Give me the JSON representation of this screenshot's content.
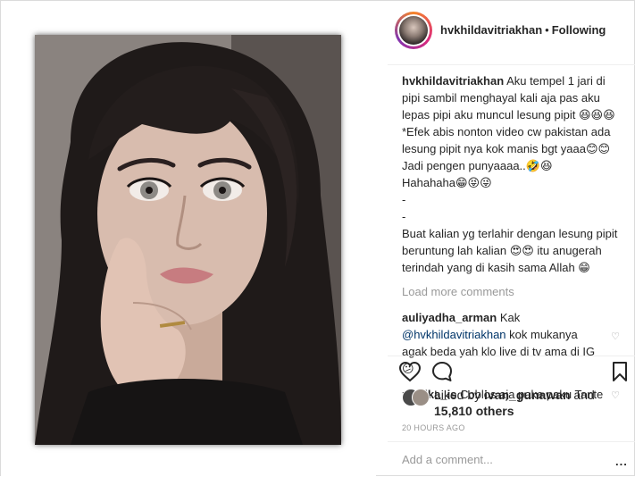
{
  "header": {
    "username": "hvkhildavitriakhan",
    "separator": "•",
    "follow_status": "Following"
  },
  "caption": {
    "username": "hvkhildavitriakhan",
    "text": "Aku tempel 1 jari di pipi sambil menghayal kali aja pas aku lepas pipi aku muncul lesung pipit 😆😆😆\n*Efek abis nonton video cw pakistan ada lesung pipit nya kok manis bgt yaaa😊😊\nJadi pengen punyaaaa..🤣😆\nHahahaha😁😝😜\n-\n-\nBuat kalian yg terlahir dengan lesung pipit beruntung lah kalian 😍😍 itu anugerah terindah yang di kasih sama Allah 😁"
  },
  "load_more": "Load more comments",
  "comments": [
    {
      "username": "auliyadha_arman",
      "text_before": "Kak",
      "mention": "@hvkhildavitriakhan",
      "text_after": "kok mukanya agak beda yah klo live di tv ama di IG 😕"
    },
    {
      "username": "zulaika_is",
      "text_before": "Coblos aja pake paku Tante",
      "mention": "",
      "text_after": ""
    }
  ],
  "actions": {
    "like_icon": "heart-icon",
    "comment_icon": "comment-bubble-icon",
    "save_icon": "bookmark-icon"
  },
  "likes": {
    "prefix": "Liked by",
    "user": "ivan_gunawan",
    "conjunction": "and",
    "others": "15,810 others"
  },
  "timestamp": "20 HOURS AGO",
  "add_comment_placeholder": "Add a comment...",
  "more_options": "..."
}
